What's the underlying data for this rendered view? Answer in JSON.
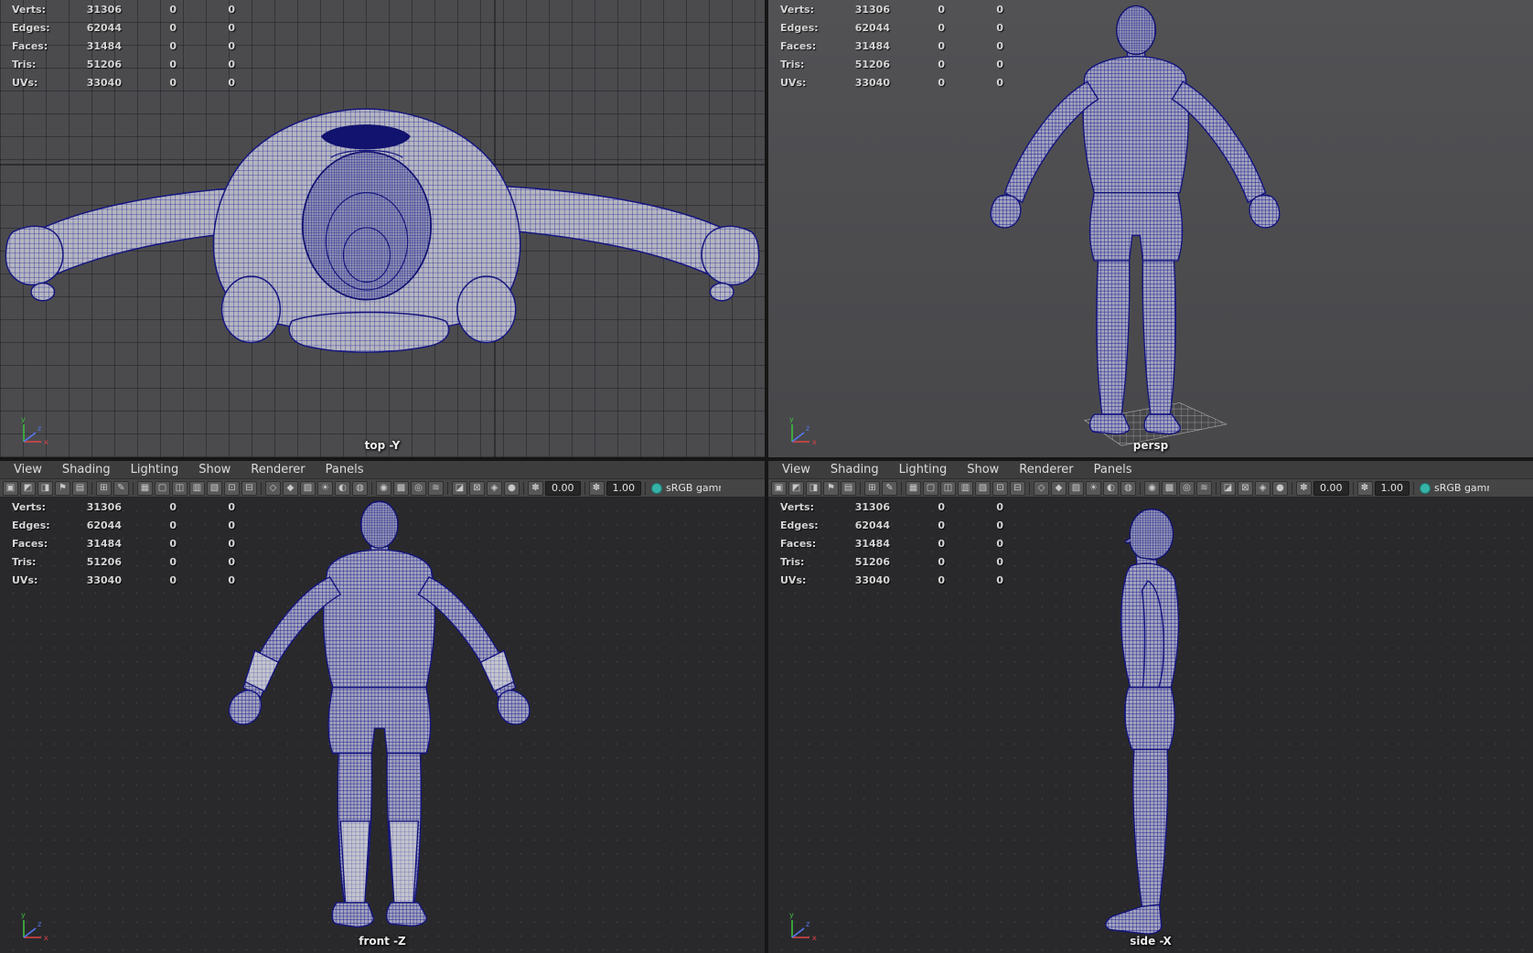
{
  "stats": {
    "rows": [
      {
        "label": "Verts:",
        "value": "31306",
        "col2": "0",
        "col3": "0"
      },
      {
        "label": "Edges:",
        "value": "62044",
        "col2": "0",
        "col3": "0"
      },
      {
        "label": "Faces:",
        "value": "31484",
        "col2": "0",
        "col3": "0"
      },
      {
        "label": "Tris:",
        "value": "51206",
        "col2": "0",
        "col3": "0"
      },
      {
        "label": "UVs:",
        "value": "33040",
        "col2": "0",
        "col3": "0"
      }
    ]
  },
  "viewports": {
    "top": {
      "label": "top -Y"
    },
    "persp": {
      "label": "persp"
    },
    "front": {
      "label": "front -Z"
    },
    "side": {
      "label": "side -X"
    }
  },
  "panel_menu": {
    "items": [
      {
        "label": "View",
        "name": "menu-view",
        "i": true
      },
      {
        "label": "Shading",
        "name": "menu-shading",
        "i": true
      },
      {
        "label": "Lighting",
        "name": "menu-lighting",
        "i": true
      },
      {
        "label": "Show",
        "name": "menu-show",
        "i": true
      },
      {
        "label": "Renderer",
        "name": "menu-renderer",
        "i": true
      },
      {
        "label": "Panels",
        "name": "menu-panels",
        "i": true
      }
    ]
  },
  "toolbar": {
    "exposure_glyph": "✽",
    "exposure_value": "0.00",
    "gamma_glyph": "✽",
    "gamma_value": "1.00",
    "view_transform": "sRGB gamm",
    "icons": [
      {
        "name": "select-camera-icon",
        "glyph": "▣",
        "i": true
      },
      {
        "name": "lock-camera-icon",
        "glyph": "◩",
        "i": true
      },
      {
        "name": "camera-attributes-icon",
        "glyph": "◨",
        "i": true
      },
      {
        "name": "bookmark-icon",
        "glyph": "⚑",
        "i": true
      },
      {
        "name": "image-plane-icon",
        "glyph": "▤",
        "i": true
      },
      {
        "name": "toolbar-separator",
        "glyph": "",
        "i": false
      },
      {
        "name": "two-d-pan-zoom-icon",
        "glyph": "⊞",
        "i": true
      },
      {
        "name": "grease-pencil-icon",
        "glyph": "✎",
        "i": true
      },
      {
        "name": "toolbar-separator",
        "glyph": "",
        "i": false
      },
      {
        "name": "grid-icon",
        "glyph": "▦",
        "i": true
      },
      {
        "name": "film-gate-icon",
        "glyph": "▢",
        "i": true
      },
      {
        "name": "resolution-gate-icon",
        "glyph": "◫",
        "i": true
      },
      {
        "name": "gate-mask-icon",
        "glyph": "▥",
        "i": true
      },
      {
        "name": "field-chart-icon",
        "glyph": "▧",
        "i": true
      },
      {
        "name": "safe-action-icon",
        "glyph": "⊡",
        "i": true
      },
      {
        "name": "safe-title-icon",
        "glyph": "⊟",
        "i": true
      },
      {
        "name": "toolbar-separator",
        "glyph": "",
        "i": false
      },
      {
        "name": "wireframe-icon",
        "glyph": "◇",
        "i": true
      },
      {
        "name": "shaded-icon",
        "glyph": "◆",
        "i": true
      },
      {
        "name": "textured-icon",
        "glyph": "▨",
        "i": true
      },
      {
        "name": "use-all-lights-icon",
        "glyph": "☀",
        "i": true
      },
      {
        "name": "shadows-icon",
        "glyph": "◐",
        "i": true
      },
      {
        "name": "screen-space-ao-icon",
        "glyph": "◍",
        "i": true
      },
      {
        "name": "toolbar-separator",
        "glyph": "",
        "i": false
      },
      {
        "name": "motion-blur-icon",
        "glyph": "◉",
        "i": true
      },
      {
        "name": "anti-aliasing-icon",
        "glyph": "▩",
        "i": true
      },
      {
        "name": "depth-of-field-icon",
        "glyph": "◎",
        "i": true
      },
      {
        "name": "hardware-fog-icon",
        "glyph": "≋",
        "i": true
      },
      {
        "name": "toolbar-separator",
        "glyph": "",
        "i": false
      },
      {
        "name": "isolate-select-icon",
        "glyph": "◪",
        "i": true
      },
      {
        "name": "xray-icon",
        "glyph": "⊠",
        "i": true
      },
      {
        "name": "wireframe-on-shaded-icon",
        "glyph": "◈",
        "i": true
      },
      {
        "name": "default-material-icon",
        "glyph": "●",
        "i": true
      },
      {
        "name": "toolbar-separator",
        "glyph": "",
        "i": false
      }
    ]
  },
  "axis": {
    "x": "x",
    "y": "y",
    "z": "z"
  },
  "colors": {
    "wireframe": "#1d1d92",
    "axis_x": "#e04444",
    "axis_y": "#3fbf3f",
    "axis_z": "#5577ee",
    "view_transform_dot": "#36b3a8"
  }
}
